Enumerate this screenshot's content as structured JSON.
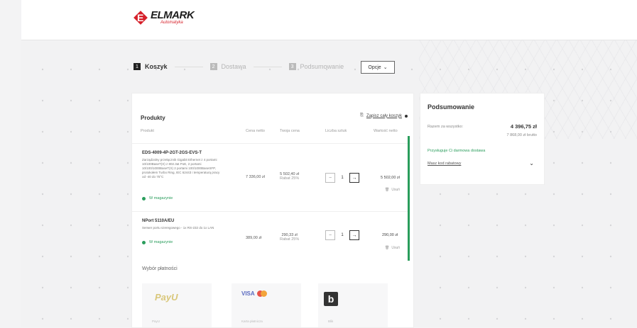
{
  "brand": {
    "name": "ELMARK",
    "sub": "Automatyka"
  },
  "steps": [
    {
      "num": "1",
      "label": "Koszyk"
    },
    {
      "num": "2",
      "label": "Dostawa"
    },
    {
      "num": "3",
      "label": "Podsumowanie"
    }
  ],
  "options_button": "Opcje",
  "products": {
    "title": "Produkty",
    "save_all": "Zapisz cały koszyk",
    "headers": {
      "product": "Produkt",
      "unit": "Cena netto",
      "price": "Twoja cena",
      "qty": "Liczba sztuk",
      "total": "Wartość netto"
    },
    "rows": [
      {
        "name": "EDS-4009-4P-2GT-2GS-EVS-T",
        "desc": "Zarządzalny przełącznik Gigabit Ethernet z 4 portami 10/100BaseT(X) z 802.3at PoE, 2 portami 10/100/1000BaseT(X) 2 portami 100/1000BaseSFP, protokołem Turbo Ring, IEC 62443 i temperaturą pracy od -40 do 75°C",
        "stock": "W magazynie",
        "unit_price": "7 336,00 zł",
        "price": "5 502,40 zł",
        "discount": "Rabat 25%",
        "qty": "1",
        "total": "5 502,00 zł",
        "delete": "Usuń"
      },
      {
        "name": "NPort 5110A/EU",
        "desc": "Serwer portu szeregowego - 1x RS-232 do 1x LAN",
        "stock": "W magazynie",
        "unit_price": "389,00 zł",
        "price": "290,33 zł",
        "discount": "Rabat 25%",
        "qty": "1",
        "total": "290,00 zł",
        "delete": "Usuń"
      }
    ]
  },
  "payment": {
    "title": "Wybór płatności",
    "methods": [
      {
        "label": "PayU",
        "caption": "PayU"
      },
      {
        "label": "VISA",
        "caption": "Karta płatnicza"
      },
      {
        "label": "b",
        "caption": "Blik"
      }
    ]
  },
  "summary": {
    "title": "Podsumowanie",
    "to_pay_label": "Razem za wszystko:",
    "to_pay_value": "4 396,75 zł",
    "brutto": "7 868,00 zł brutto",
    "shipping": "Przysługuje Ci darmowa dostawa",
    "discount_code": "Masz kod rabatowy",
    "chevron": "⌄"
  },
  "colors": {
    "accent_green": "#2a9d5c",
    "brand_red": "#d6202a"
  }
}
